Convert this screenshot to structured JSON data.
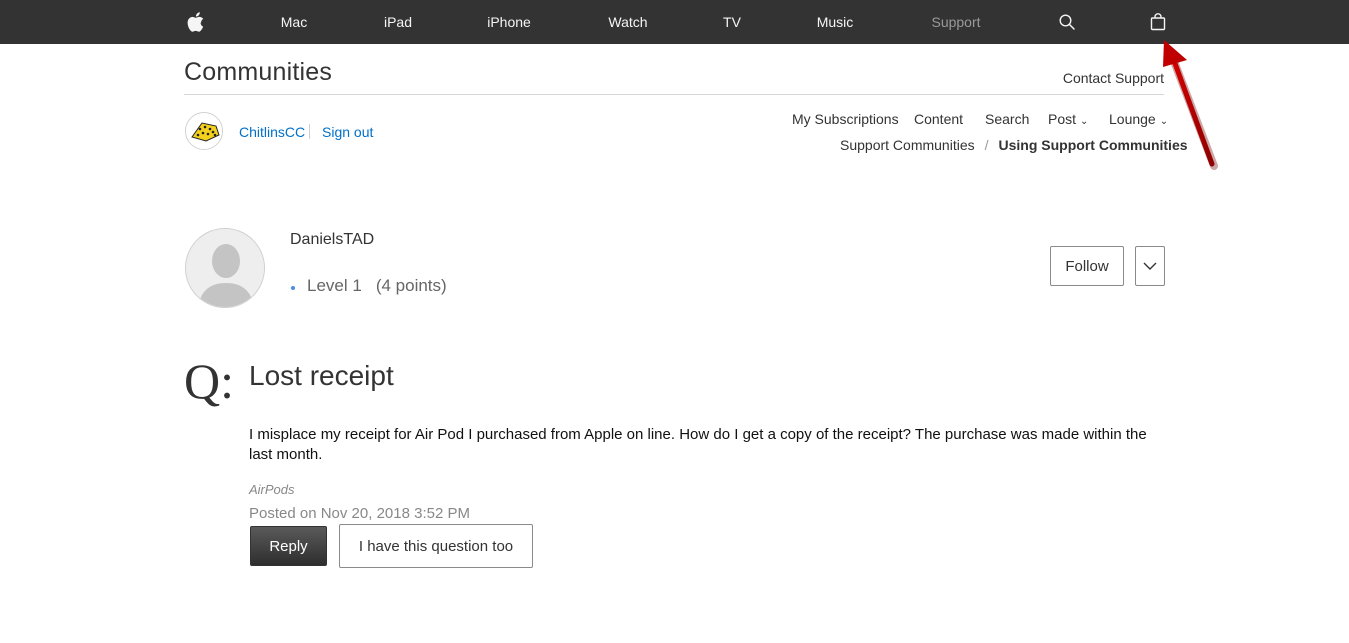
{
  "global_nav": {
    "items": [
      {
        "label": "Mac"
      },
      {
        "label": "iPad"
      },
      {
        "label": "iPhone"
      },
      {
        "label": "Watch"
      },
      {
        "label": "TV"
      },
      {
        "label": "Music"
      },
      {
        "label": "Support",
        "active": true
      }
    ],
    "icons": [
      "apple-logo-icon",
      "search-icon",
      "shopping-bag-icon"
    ]
  },
  "header": {
    "title": "Communities",
    "contact_link": "Contact Support"
  },
  "user": {
    "name": "ChitlinsCC",
    "sign_out": "Sign out"
  },
  "subnav": {
    "items": [
      {
        "label": "My Subscriptions"
      },
      {
        "label": "Content"
      },
      {
        "label": "Search"
      },
      {
        "label": "Post",
        "dropdown": true
      },
      {
        "label": "Lounge",
        "dropdown": true
      }
    ]
  },
  "breadcrumb": {
    "parent": "Support Communities",
    "separator": "/",
    "current": "Using Support Communities"
  },
  "author": {
    "name": "DanielsTAD",
    "level": "Level 1",
    "points": "(4 points)",
    "follow_label": "Follow"
  },
  "question": {
    "marker": "Q:",
    "title": "Lost receipt",
    "body": "I misplace my receipt for Air Pod I purchased from Apple on line.  How do I get a copy of the receipt?  The purchase was made within the last month.",
    "tag": "AirPods",
    "posted": "Posted on Nov 20, 2018 3:52 PM",
    "reply_label": "Reply",
    "same_question_label": "I have this question too"
  },
  "colors": {
    "nav_bg": "#333333",
    "link": "#0070c9",
    "annotation_arrow": "#c00000"
  }
}
